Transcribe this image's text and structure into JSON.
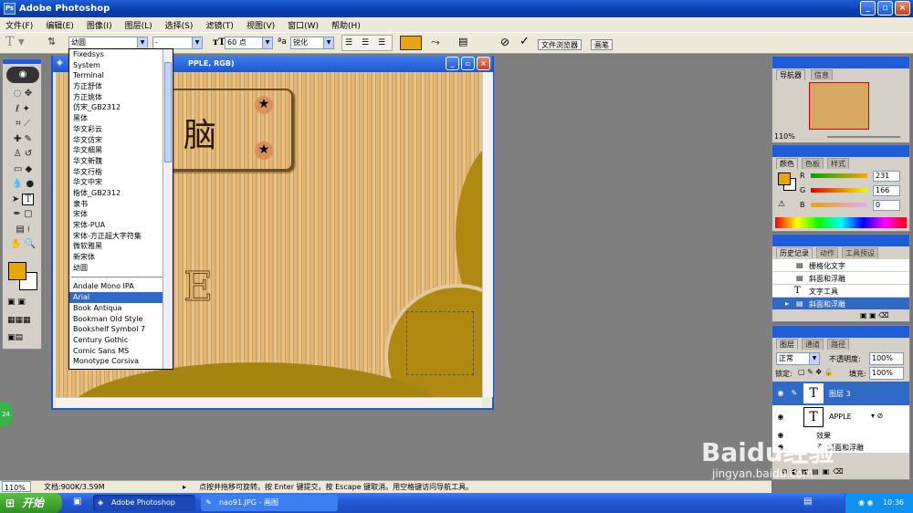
{
  "app": {
    "title": "Adobe Photoshop",
    "icon_label": "Ps"
  },
  "window_controls": {
    "minimize": "_",
    "restore": "▫",
    "close": "×"
  },
  "menu": [
    "文件(F)",
    "编辑(E)",
    "图像(I)",
    "图层(L)",
    "选择(S)",
    "滤镜(T)",
    "视图(V)",
    "窗口(W)",
    "帮助(H)"
  ],
  "options_bar": {
    "font_family": "幼圆",
    "font_style": "-",
    "font_size": "60 点",
    "anti_alias": "锐化",
    "text_color": "#e8a317",
    "cancel_glyph": "⊘",
    "commit_glyph": "✓",
    "file_browser_tab": "文件浏览器",
    "brushes_tab": "画笔"
  },
  "document": {
    "title_suffix": "PPLE, RGB)",
    "canvas_text_1": "脑",
    "canvas_text_2": "E"
  },
  "font_list": {
    "cjk_fonts": [
      "Fixedsys",
      "System",
      "Terminal",
      "方正舒体",
      "方正姚体",
      "仿宋_GB2312",
      "黑体",
      "华文彩云",
      "华文仿宋",
      "华文细黑",
      "华文新魏",
      "华文行楷",
      "华文中宋",
      "楷体_GB2312",
      "隶书",
      "宋体",
      "宋体-PUA",
      "宋体-方正超大字符集",
      "微软雅黑",
      "新宋体",
      "幼圆"
    ],
    "latin_fonts": [
      "Andale Mono IPA",
      "Arial",
      "Book Antiqua",
      "Bookman Old Style",
      "Bookshelf Symbol 7",
      "Century Gothic",
      "Comic Sans MS",
      "Monotype Corsiva"
    ],
    "selected": "Arial"
  },
  "navigator": {
    "tabs": [
      "导航器",
      "信息"
    ],
    "zoom": "110%"
  },
  "color_panel": {
    "tabs": [
      "颜色",
      "色板",
      "样式"
    ],
    "r_label": "R",
    "r_value": "231",
    "g_label": "G",
    "g_value": "166",
    "b_label": "B",
    "b_value": "0",
    "foreground": "#e8a600"
  },
  "history": {
    "tabs": [
      "历史记录",
      "动作",
      "工具预设"
    ],
    "items": [
      "栅格化文字",
      "斜面和浮雕",
      "文字工具",
      "斜面和浮雕"
    ]
  },
  "layers": {
    "tabs": [
      "图层",
      "通道",
      "路径"
    ],
    "blend_mode": "正常",
    "opacity_label": "不透明度:",
    "opacity": "100%",
    "lock_label": "锁定:",
    "fill_label": "填充:",
    "fill": "100%",
    "items": [
      "图层 3",
      "APPLE",
      "效果",
      "斜面和浮雕"
    ]
  },
  "status": {
    "zoom": "110%",
    "doc_size": "文档:900K/3.59M",
    "hint": "点按并拖移可旋转。按 Enter 键提交。按 Escape 键取消。用空格键访问导航工具。"
  },
  "taskbar": {
    "start": "开始",
    "tasks": [
      "Adobe Photoshop",
      "nao91.JPG - 画图"
    ],
    "clock": "10:36"
  },
  "side_badge": "24",
  "watermark": {
    "brand": "Baidu经验",
    "url": "jingyan.baidu.com"
  }
}
